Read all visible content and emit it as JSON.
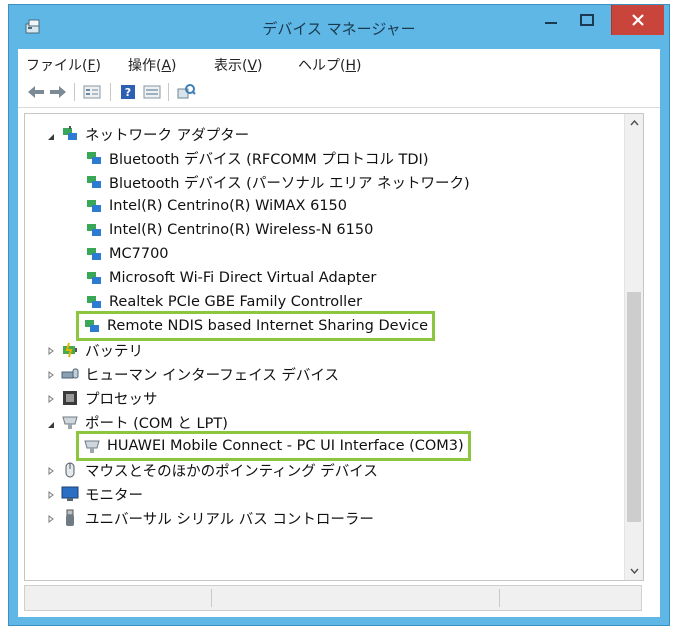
{
  "window": {
    "title": "デバイス マネージャー",
    "colors": {
      "frame": "#5fb7e6",
      "close": "#c9443a",
      "highlight": "#8cc63f"
    }
  },
  "menu": [
    {
      "label": "ファイル(",
      "key": "F",
      "end": ")"
    },
    {
      "label": "操作(",
      "key": "A",
      "end": ")"
    },
    {
      "label": "表示(",
      "key": "V",
      "end": ")"
    },
    {
      "label": "ヘルプ(",
      "key": "H",
      "end": ")"
    }
  ],
  "toolbar_icons": [
    "back-icon",
    "forward-icon",
    "properties-icon",
    "help-icon",
    "details-icon",
    "scan-hardware-icon"
  ],
  "tree": {
    "network_adapters": {
      "label": "ネットワーク アダプター",
      "expanded": true,
      "children": [
        "Bluetooth デバイス (RFCOMM プロトコル TDI)",
        "Bluetooth デバイス (パーソナル エリア ネットワーク)",
        "Intel(R) Centrino(R) WiMAX 6150",
        "Intel(R) Centrino(R) Wireless-N 6150",
        "MC7700",
        "Microsoft Wi-Fi Direct Virtual Adapter",
        "Realtek PCIe GBE Family Controller",
        "Remote NDIS based Internet Sharing Device"
      ]
    },
    "battery": {
      "label": "バッテリ"
    },
    "hid": {
      "label": "ヒューマン インターフェイス デバイス"
    },
    "processor": {
      "label": "プロセッサ"
    },
    "ports": {
      "label": "ポート (COM と LPT)",
      "expanded": true,
      "children": [
        "HUAWEI Mobile Connect - PC UI Interface (COM3)"
      ]
    },
    "mice": {
      "label": "マウスとそのほかのポインティング デバイス"
    },
    "monitor": {
      "label": "モニター"
    },
    "usb": {
      "label": "ユニバーサル シリアル バス コントローラー"
    }
  }
}
